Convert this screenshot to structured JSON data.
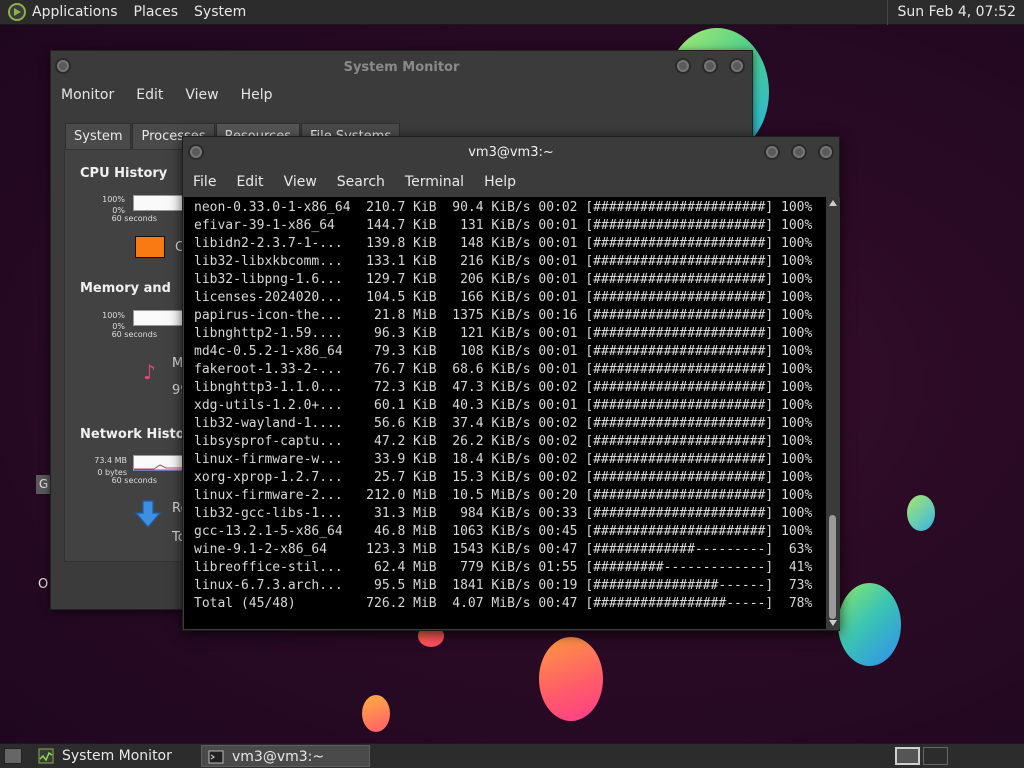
{
  "top_panel": {
    "menus": [
      "Applications",
      "Places",
      "System"
    ],
    "clock": "Sun Feb  4, 07:52"
  },
  "desktop": {
    "frag_g": "G",
    "frag_o": "O"
  },
  "system_monitor": {
    "title": "System Monitor",
    "menu": [
      "Monitor",
      "Edit",
      "View",
      "Help"
    ],
    "tabs": [
      "System",
      "Processes",
      "Resources",
      "File Systems"
    ],
    "active_tab": "Resources",
    "cpu": {
      "title": "CPU History",
      "y_max": "100%",
      "y_min": "0%",
      "x": "60 seconds",
      "label_frag": "C"
    },
    "memory": {
      "title": "Memory and Swap History",
      "title_visible": "Memory and Swa",
      "y_max": "100%",
      "y_min": "0%",
      "x": "60 seconds",
      "label_frag": "M",
      "value_frag": "99"
    },
    "network": {
      "title": "Network History",
      "y_max": "73.4 MB",
      "y_min": "0 bytes",
      "x": "60 seconds",
      "recv_frag": "Re",
      "total_frag": "To"
    }
  },
  "terminal": {
    "title": "vm3@vm3:~",
    "menu": [
      "File",
      "Edit",
      "View",
      "Search",
      "Terminal",
      "Help"
    ],
    "lines": [
      "neon-0.33.0-1-x86_64  210.7 KiB  90.4 KiB/s 00:02 [######################] 100%",
      "efivar-39-1-x86_64    144.7 KiB   131 KiB/s 00:01 [######################] 100%",
      "libidn2-2.3.7-1-...   139.8 KiB   148 KiB/s 00:01 [######################] 100%",
      "lib32-libxkbcomm...   133.1 KiB   216 KiB/s 00:01 [######################] 100%",
      "lib32-libpng-1.6...   129.7 KiB   206 KiB/s 00:01 [######################] 100%",
      "licenses-2024020...   104.5 KiB   166 KiB/s 00:01 [######################] 100%",
      "papirus-icon-the...    21.8 MiB  1375 KiB/s 00:16 [######################] 100%",
      "libnghttp2-1.59....    96.3 KiB   121 KiB/s 00:01 [######################] 100%",
      "md4c-0.5.2-1-x86_64    79.3 KiB   108 KiB/s 00:01 [######################] 100%",
      "fakeroot-1.33-2-...    76.7 KiB  68.6 KiB/s 00:01 [######################] 100%",
      "libnghttp3-1.1.0...    72.3 KiB  47.3 KiB/s 00:02 [######################] 100%",
      "xdg-utils-1.2.0+...    60.1 KiB  40.3 KiB/s 00:01 [######################] 100%",
      "lib32-wayland-1....    56.6 KiB  37.4 KiB/s 00:02 [######################] 100%",
      "libsysprof-captu...    47.2 KiB  26.2 KiB/s 00:02 [######################] 100%",
      "linux-firmware-w...    33.9 KiB  18.4 KiB/s 00:02 [######################] 100%",
      "xorg-xprop-1.2.7...    25.7 KiB  15.3 KiB/s 00:02 [######################] 100%",
      "linux-firmware-2...   212.0 MiB  10.5 MiB/s 00:20 [######################] 100%",
      "lib32-gcc-libs-1...    31.3 MiB   984 KiB/s 00:33 [######################] 100%",
      "gcc-13.2.1-5-x86_64    46.8 MiB  1063 KiB/s 00:45 [######################] 100%",
      "wine-9.1-2-x86_64     123.3 MiB  1543 KiB/s 00:47 [#############---------]  63%",
      "libreoffice-stil...    62.4 MiB   779 KiB/s 01:55 [#########-------------]  41%",
      "linux-6.7.3.arch...    95.5 MiB  1841 KiB/s 00:19 [################------]  73%",
      "Total (45/48)         726.2 MiB  4.07 MiB/s 00:47 [#################-----]  78%"
    ]
  },
  "taskbar": {
    "tasks": [
      {
        "label": "System Monitor",
        "active": false
      },
      {
        "label": "vm3@vm3:~",
        "active": true
      }
    ]
  }
}
